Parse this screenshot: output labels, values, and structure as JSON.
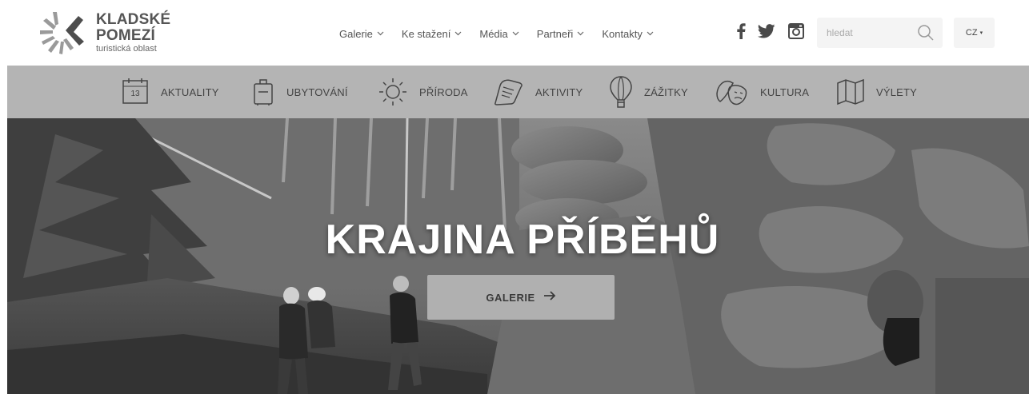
{
  "brand": {
    "title": "KLADSKÉ POMEZÍ",
    "subtitle": "turistická oblast"
  },
  "topnav": [
    {
      "label": "Galerie",
      "icon": "chevron-down-icon"
    },
    {
      "label": "Ke stažení",
      "icon": "chevron-down-icon"
    },
    {
      "label": "Média",
      "icon": "chevron-down-icon"
    },
    {
      "label": "Partneři",
      "icon": "chevron-down-icon"
    },
    {
      "label": "Kontakty",
      "icon": "chevron-down-icon"
    }
  ],
  "social": [
    "facebook-icon",
    "twitter-icon",
    "instagram-icon"
  ],
  "search": {
    "placeholder": "hledat",
    "icon": "search-icon"
  },
  "language": {
    "current": "CZ",
    "icon": "caret-down-icon"
  },
  "categories": [
    {
      "label": "AKTUALITY",
      "icon": "calendar-icon",
      "icon_text": "13"
    },
    {
      "label": "UBYTOVÁNÍ",
      "icon": "suitcase-icon"
    },
    {
      "label": "PŘÍRODA",
      "icon": "sun-icon"
    },
    {
      "label": "AKTIVITY",
      "icon": "shoe-icon"
    },
    {
      "label": "ZÁŽITKY",
      "icon": "balloon-icon"
    },
    {
      "label": "KULTURA",
      "icon": "masks-icon"
    },
    {
      "label": "VÝLETY",
      "icon": "map-icon"
    }
  ],
  "hero": {
    "title": "KRAJINA PŘÍBĚHŮ",
    "button_label": "GALERIE",
    "button_icon": "arrow-right-icon",
    "image": "forest-rocks-hikers-photo"
  },
  "colors": {
    "category_bar": "#b4b4b4",
    "hero_button": "#b0b0b0",
    "hero_text": "#ffffff",
    "input_bg": "#f4f4f4"
  }
}
